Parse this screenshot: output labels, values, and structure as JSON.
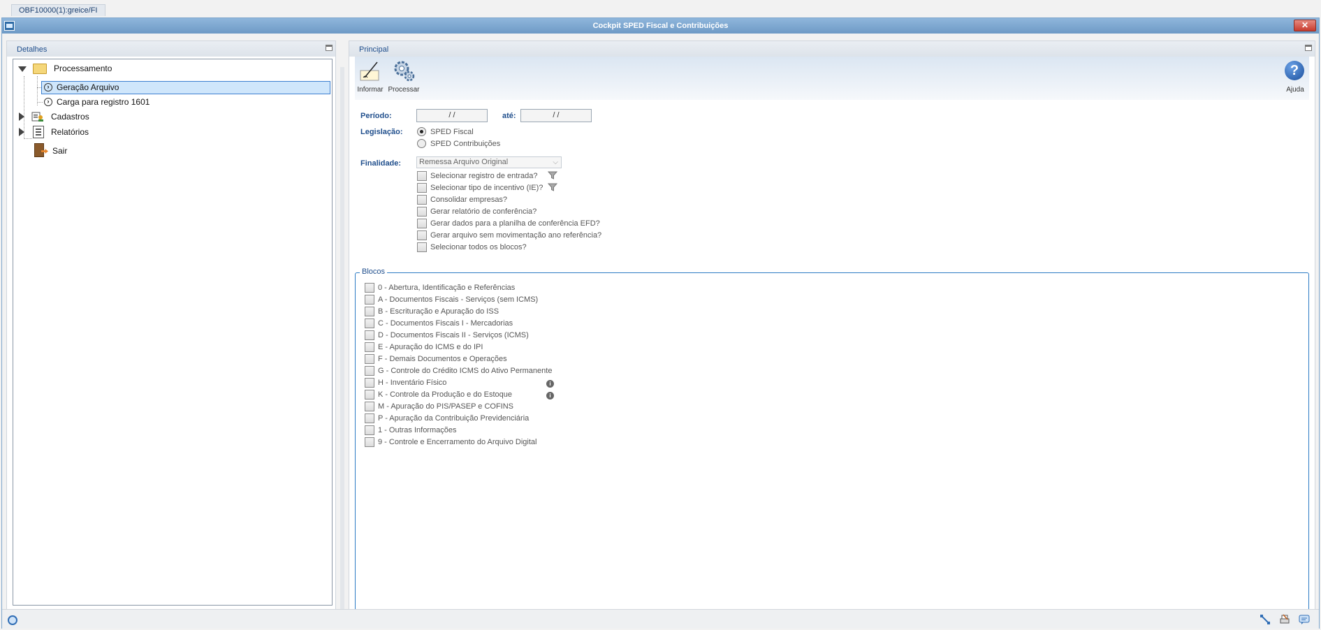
{
  "top_tab": {
    "label": "OBF10000(1):greice/FI"
  },
  "window": {
    "title": "Cockpit SPED Fiscal e Contribuições",
    "close_label": "✕"
  },
  "left_panel": {
    "title": "Detalhes",
    "tree": {
      "processamento": "Processamento",
      "geracao_arquivo": "Geração Arquivo",
      "carga_registro": "Carga para registro 1601",
      "cadastros": "Cadastros",
      "relatorios": "Relatórios",
      "sair": "Sair"
    }
  },
  "right_panel": {
    "title": "Principal",
    "toolbar": {
      "informar": "Informar",
      "processar": "Processar",
      "ajuda": "Ajuda",
      "help_glyph": "?"
    },
    "form": {
      "periodo_label": "Período:",
      "periodo_from": " / /",
      "ate_label": "até:",
      "periodo_to": " / /",
      "legislacao_label": "Legislação:",
      "legislacao_options": [
        "SPED Fiscal",
        "SPED Contribuições"
      ],
      "legislacao_selected": "SPED Fiscal",
      "finalidade_label": "Finalidade:",
      "finalidade_value": "Remessa Arquivo Original",
      "options": [
        "Selecionar registro de entrada?",
        "Selecionar tipo de incentivo (IE)?",
        "Consolidar empresas?",
        "Gerar relatório de conferência?",
        "Gerar dados para a planilha de conferência EFD?",
        "Gerar arquivo sem movimentação ano referência?",
        "Selecionar todos os blocos?"
      ]
    },
    "blocos": {
      "title": "Blocos",
      "items": [
        "0 - Abertura, Identificação  e Referências",
        "A - Documentos Fiscais -  Serviços (sem ICMS)",
        "B - Escrituração e Apuração do ISS",
        "C - Documentos Fiscais I - Mercadorias",
        "D - Documentos Fiscais II - Serviços (ICMS)",
        "E - Apuração do ICMS e do IPI",
        "F - Demais Documentos e Operações",
        "G - Controle do Crédito ICMS do Ativo Permanente",
        "H - Inventário Físico",
        "K - Controle da Produção e do Estoque",
        "M - Apuração do PIS/PASEP e COFINS",
        "P - Apuração da Contribuição Previdenciária",
        "1 - Outras Informações",
        "9 - Controle e Encerramento do Arquivo Digital"
      ],
      "info_glyph": "i"
    }
  },
  "colors": {
    "accent": "#1f4e8c",
    "title_bar": "#6e9ac6",
    "group_border": "#2d7bc4"
  }
}
